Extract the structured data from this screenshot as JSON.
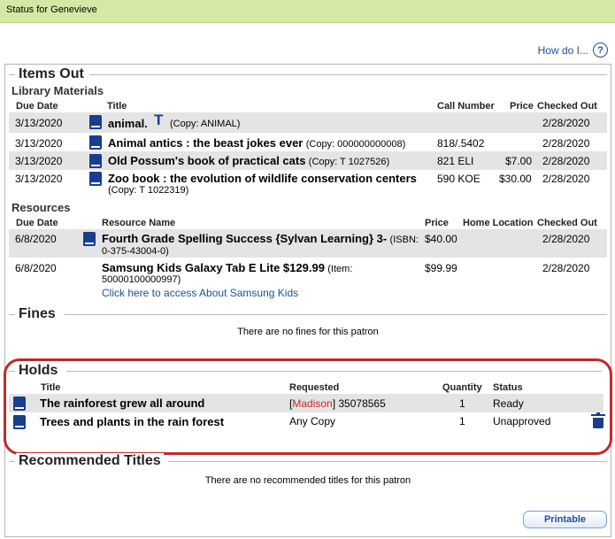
{
  "header": {
    "title": "Status for Genevieve"
  },
  "help": {
    "label": "How do I...",
    "icon": "help-icon"
  },
  "items_out": {
    "section_title": "Items Out",
    "library_materials": {
      "title": "Library Materials",
      "columns": [
        "Due Date",
        "Title",
        "Call Number",
        "Price",
        "Checked Out"
      ],
      "rows": [
        {
          "due": "3/13/2020",
          "title": "animal.",
          "copy": "(Copy: ANIMAL)",
          "call": "",
          "price": "",
          "checked_out": "2/28/2020"
        },
        {
          "due": "3/13/2020",
          "title": "Animal antics : the beast jokes ever",
          "copy": "(Copy: 000000000008)",
          "call": "818/.5402",
          "price": "",
          "checked_out": "2/28/2020"
        },
        {
          "due": "3/13/2020",
          "title": "Old Possum's book of practical cats",
          "copy": "(Copy: T 1027526)",
          "call": "821 ELI",
          "price": "$7.00",
          "checked_out": "2/28/2020"
        },
        {
          "due": "3/13/2020",
          "title": "Zoo book : the evolution of wildlife conservation centers",
          "copy": "(Copy: T 1022319)",
          "call": "590 KOE",
          "price": "$30.00",
          "checked_out": "2/28/2020"
        }
      ]
    },
    "resources": {
      "title": "Resources",
      "columns": [
        "Due Date",
        "Resource Name",
        "Price",
        "Home Location",
        "Checked Out"
      ],
      "rows": [
        {
          "due": "6/8/2020",
          "name": "Fourth Grade Spelling Success {Sylvan Learning} 3-",
          "detail_line1": "(ISBN:",
          "detail_line2": "0-375-43004-0)",
          "price": "$40.00",
          "location": "",
          "checked_out": "2/28/2020"
        },
        {
          "due": "6/8/2020",
          "name": "Samsung Kids Galaxy Tab E Lite $129.99",
          "detail_line1": "(Item:",
          "detail_line2": "50000100000997)",
          "link": "Click here to access About Samsung Kids",
          "price": "$99.99",
          "location": "",
          "checked_out": "2/28/2020"
        }
      ]
    }
  },
  "fines": {
    "section_title": "Fines",
    "message": "There are no fines for this patron"
  },
  "holds": {
    "section_title": "Holds",
    "columns": [
      "Title",
      "Requested",
      "Quantity",
      "Status"
    ],
    "rows": [
      {
        "title": "The rainforest grew all around",
        "requested_branch": "Madison",
        "requested_rest": "35078565",
        "quantity": "1",
        "status": "Ready"
      },
      {
        "title": "Trees and plants in the rain forest",
        "requested": "Any Copy",
        "quantity": "1",
        "status": "Unapproved"
      }
    ]
  },
  "recommended": {
    "section_title": "Recommended Titles",
    "message": "There are no recommended titles for this patron"
  },
  "footer": {
    "printable_label": "Printable"
  }
}
